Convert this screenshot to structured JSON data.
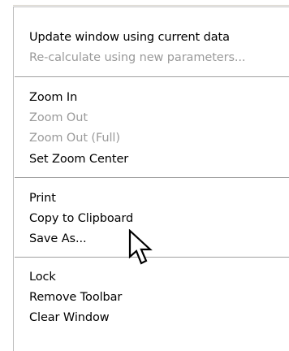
{
  "menu": {
    "groups": [
      {
        "items": [
          {
            "label": "Update window using current data",
            "enabled": true
          },
          {
            "label": "Re-calculate using new parameters...",
            "enabled": false
          }
        ]
      },
      {
        "items": [
          {
            "label": "Zoom In",
            "enabled": true
          },
          {
            "label": "Zoom Out",
            "enabled": false
          },
          {
            "label": "Zoom Out (Full)",
            "enabled": false
          },
          {
            "label": "Set Zoom Center",
            "enabled": true
          }
        ]
      },
      {
        "items": [
          {
            "label": "Print",
            "enabled": true
          },
          {
            "label": "Copy to Clipboard",
            "enabled": true
          },
          {
            "label": "Save As...",
            "enabled": true
          }
        ]
      },
      {
        "items": [
          {
            "label": "Lock",
            "enabled": true
          },
          {
            "label": "Remove Toolbar",
            "enabled": true
          },
          {
            "label": "Clear Window",
            "enabled": true
          }
        ]
      }
    ]
  },
  "colors": {
    "text": "#000000",
    "disabled_text": "#9a9a9a",
    "separator": "#a0a0a0",
    "background": "#ffffff"
  },
  "cursor": {
    "icon": "arrow-pointer-icon"
  }
}
